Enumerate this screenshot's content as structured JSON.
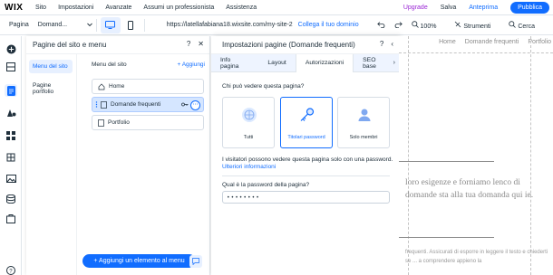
{
  "topbar": {
    "logo": "WIX",
    "menu": [
      "Sito",
      "Impostazioni",
      "Avanzate",
      "Assumi un professionista",
      "Assistenza"
    ],
    "upgrade": "Upgrade",
    "save": "Salva",
    "preview": "Anteprima",
    "publish": "Pubblica"
  },
  "toolbar": {
    "page_label": "Pagina",
    "page_value": "Domand...",
    "url": "https://latellafabiana18.wixsite.com/my-site-2",
    "connect_domain": "Collega il tuo dominio",
    "zoom": "100%",
    "tools": "Strumenti",
    "search": "Cerca"
  },
  "pages_panel": {
    "title": "Pagine del sito e menu",
    "nav": [
      "Menu del sito",
      "Pagine portfolio"
    ],
    "menu_label": "Menu del sito",
    "add_link": "+ Aggiungi",
    "pages": [
      "Home",
      "Domande frequenti",
      "Portfolio"
    ],
    "add_element_button": "+ Aggiungi un elemento al menu"
  },
  "settings_panel": {
    "title": "Impostazioni pagine (Domande frequenti)",
    "tabs": [
      "Info pagina",
      "Layout",
      "Autorizzazioni",
      "SEO base"
    ],
    "who_label": "Chi può vedere questa pagina?",
    "options": [
      "Tutti",
      "Titolari password",
      "Solo membri"
    ],
    "info_text": "I visitatori possono vedere questa pagina solo con una password.",
    "info_link": "Ulteriori informazioni",
    "password_label": "Qual è la password della pagina?",
    "password_value": "••••••••"
  },
  "site_preview": {
    "nav": [
      "Home",
      "Domande frequenti",
      "Portfolio"
    ],
    "body_text": "loro esigenze e forniamo lenco di domande sta alla tua domanda qui ie.",
    "faq_text": "frequenti. Assicurati di esporre in leggere il testo e chiederti se ... a comprendere appieno la"
  },
  "colors": {
    "accent": "#116dff",
    "upgrade": "#9a27d5",
    "selected_bg": "#d5e6ff"
  }
}
